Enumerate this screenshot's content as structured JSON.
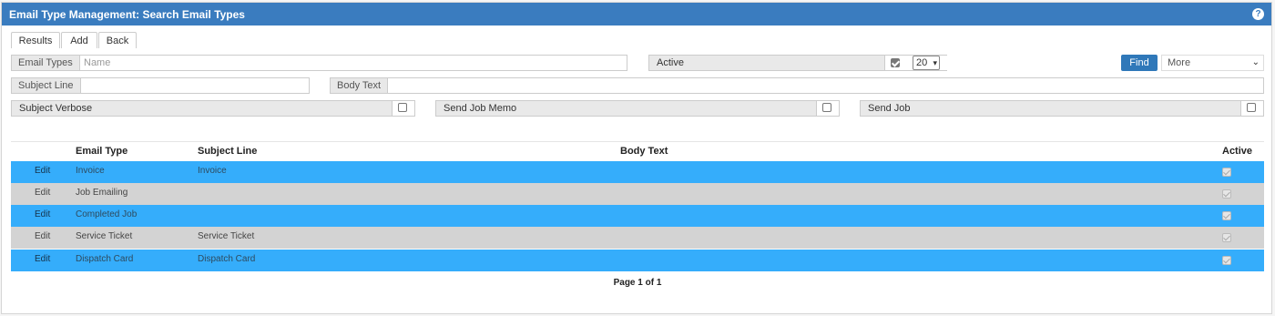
{
  "title": "Email Type Management: Search Email Types",
  "help_icon": "?",
  "tabs": [
    "Results",
    "Add",
    "Back"
  ],
  "filters": {
    "email_types_label": "Email Types",
    "email_types_placeholder": "Name",
    "active_label": "Active",
    "active_checked": true,
    "page_size": "20",
    "find_label": "Find",
    "more_label": "More",
    "subject_line_label": "Subject Line",
    "body_text_label": "Body Text",
    "subject_verbose_label": "Subject Verbose",
    "send_job_memo_label": "Send Job Memo",
    "send_job_label": "Send Job"
  },
  "table": {
    "headers": [
      "Email Type",
      "Subject Line",
      "Body Text",
      "Active"
    ],
    "edit_label": "Edit",
    "rows": [
      {
        "email_type": "Invoice",
        "subject_line": "Invoice",
        "body_text": "",
        "active": true
      },
      {
        "email_type": "Job Emailing",
        "subject_line": "",
        "body_text": "",
        "active": true
      },
      {
        "email_type": "Completed Job",
        "subject_line": "",
        "body_text": "",
        "active": true
      },
      {
        "email_type": "Service Ticket",
        "subject_line": "Service Ticket",
        "body_text": "",
        "active": true
      },
      {
        "email_type": "Dispatch Card",
        "subject_line": "Dispatch Card",
        "body_text": "",
        "active": true
      }
    ]
  },
  "pager": "Page 1 of 1",
  "colors": {
    "header": "#3a7cbf",
    "row_blue": "#35adfb",
    "row_gray": "#d3d3d3",
    "find_button": "#2f78b9"
  }
}
